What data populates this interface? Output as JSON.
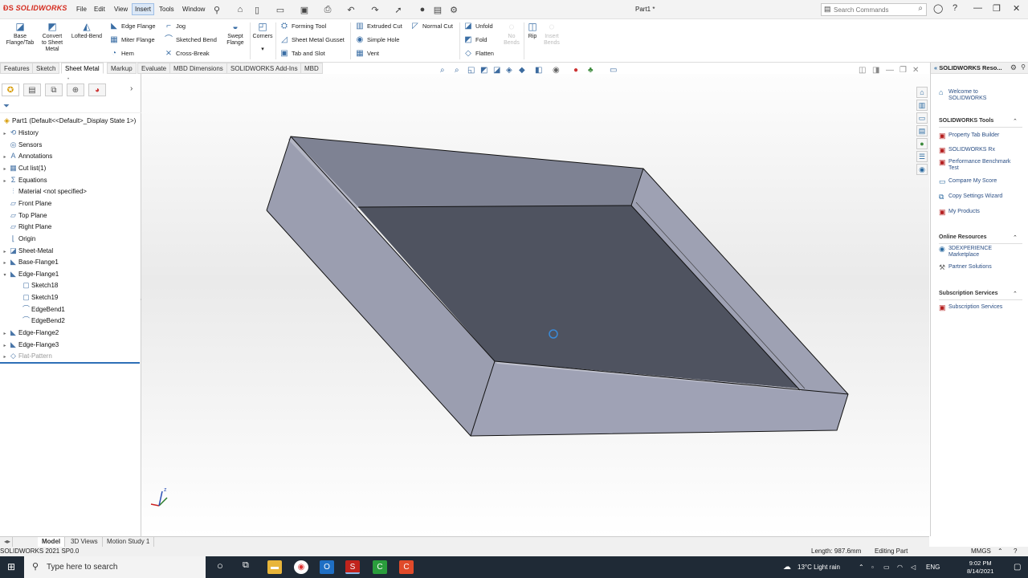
{
  "app": {
    "logo": "SOLIDWORKS",
    "document_title": "Part1 *",
    "menus": [
      "File",
      "Edit",
      "View",
      "Insert",
      "Tools",
      "Window"
    ],
    "active_menu": "Insert",
    "search_placeholder": "Search Commands",
    "accent_color": "#d52b1e"
  },
  "ribbon": {
    "big_buttons": [
      {
        "label": "Base\nFlange/Tab",
        "icon": "base-flange-icon"
      },
      {
        "label": "Convert\nto Sheet\nMetal",
        "icon": "convert-sheet-icon"
      },
      {
        "label": "Lofted-Bend",
        "icon": "lofted-bend-icon"
      }
    ],
    "col1": [
      "Edge Flange",
      "Miter Flange",
      "Hem"
    ],
    "col2": [
      "Jog",
      "Sketched Bend",
      "Cross-Break"
    ],
    "swept_flange": "Swept\nFlange",
    "corners": "Corners",
    "col3": [
      "Forming Tool",
      "Sheet Metal Gusset",
      "Tab and Slot"
    ],
    "col4": [
      "Extruded Cut",
      "Simple Hole",
      "Vent"
    ],
    "normal_cut": "Normal Cut",
    "col5": [
      "Unfold",
      "Fold",
      "Flatten"
    ],
    "no_bends": "No\nBends",
    "rip": "Rip",
    "insert_bends": "Insert\nBends"
  },
  "cm_tabs": [
    "Features",
    "Sketch",
    "Sheet Metal",
    "Markup",
    "Evaluate",
    "MBD Dimensions",
    "SOLIDWORKS Add-Ins",
    "MBD"
  ],
  "active_cm_tab": "Sheet Metal",
  "tree": {
    "root": "Part1  (Default<<Default>_Display State 1>)",
    "items": [
      {
        "label": "History",
        "icon": "history-icon",
        "arrow": "▸",
        "indent": 0
      },
      {
        "label": "Sensors",
        "icon": "sensor-icon",
        "arrow": "",
        "indent": 0
      },
      {
        "label": "Annotations",
        "icon": "annotation-icon",
        "arrow": "▸",
        "indent": 0
      },
      {
        "label": "Cut list(1)",
        "icon": "cutlist-icon",
        "arrow": "▸",
        "indent": 0
      },
      {
        "label": "Equations",
        "icon": "equations-icon",
        "arrow": "▸",
        "indent": 0
      },
      {
        "label": "Material <not specified>",
        "icon": "material-icon",
        "arrow": "",
        "indent": 0
      },
      {
        "label": "Front Plane",
        "icon": "plane-icon",
        "arrow": "",
        "indent": 0
      },
      {
        "label": "Top Plane",
        "icon": "plane-icon",
        "arrow": "",
        "indent": 0
      },
      {
        "label": "Right Plane",
        "icon": "plane-icon",
        "arrow": "",
        "indent": 0
      },
      {
        "label": "Origin",
        "icon": "origin-icon",
        "arrow": "",
        "indent": 0
      },
      {
        "label": "Sheet-Metal",
        "icon": "sheetmetal-icon",
        "arrow": "▸",
        "indent": 0
      },
      {
        "label": "Base-Flange1",
        "icon": "flange-icon",
        "arrow": "▸",
        "indent": 0
      },
      {
        "label": "Edge-Flange1",
        "icon": "flange-icon",
        "arrow": "▾",
        "indent": 0
      },
      {
        "label": "Sketch18",
        "icon": "sketch-icon",
        "arrow": "",
        "indent": 1
      },
      {
        "label": "Sketch19",
        "icon": "sketch-icon",
        "arrow": "",
        "indent": 1
      },
      {
        "label": "EdgeBend1",
        "icon": "bend-icon",
        "arrow": "",
        "indent": 1
      },
      {
        "label": "EdgeBend2",
        "icon": "bend-icon",
        "arrow": "",
        "indent": 1
      },
      {
        "label": "Edge-Flange2",
        "icon": "flange-icon",
        "arrow": "▸",
        "indent": 0
      },
      {
        "label": "Edge-Flange3",
        "icon": "flange-icon",
        "arrow": "▸",
        "indent": 0
      },
      {
        "label": "Flat-Pattern",
        "icon": "flatpattern-icon",
        "arrow": "▸",
        "indent": 0,
        "gray": true
      }
    ]
  },
  "right_panel": {
    "header": "SOLIDWORKS Reso...",
    "welcome": "Welcome to\nSOLIDWORKS",
    "tools_title": "SOLIDWORKS Tools",
    "tools": [
      "Property Tab Builder",
      "SOLIDWORKS Rx",
      "Performance Benchmark\nTest",
      "Compare My Score",
      "Copy Settings Wizard",
      "My Products"
    ],
    "online_title": "Online Resources",
    "online": [
      "3DEXPERIENCE\nMarketplace",
      "Partner Solutions"
    ],
    "subs_title": "Subscription Services",
    "subs": [
      "Subscription Services"
    ]
  },
  "bottom_tabs": [
    "Model",
    "3D Views",
    "Motion Study 1"
  ],
  "active_bottom_tab": "Model",
  "status": {
    "version": "SOLIDWORKS 2021 SP0.0",
    "length": "Length: 987.6mm",
    "mode": "Editing Part",
    "units": "MMGS"
  },
  "taskbar": {
    "search_placeholder": "Type here to search",
    "weather": "13°C  Light rain",
    "lang": "ENG",
    "time": "9:02 PM",
    "date": "8/14/2021"
  }
}
